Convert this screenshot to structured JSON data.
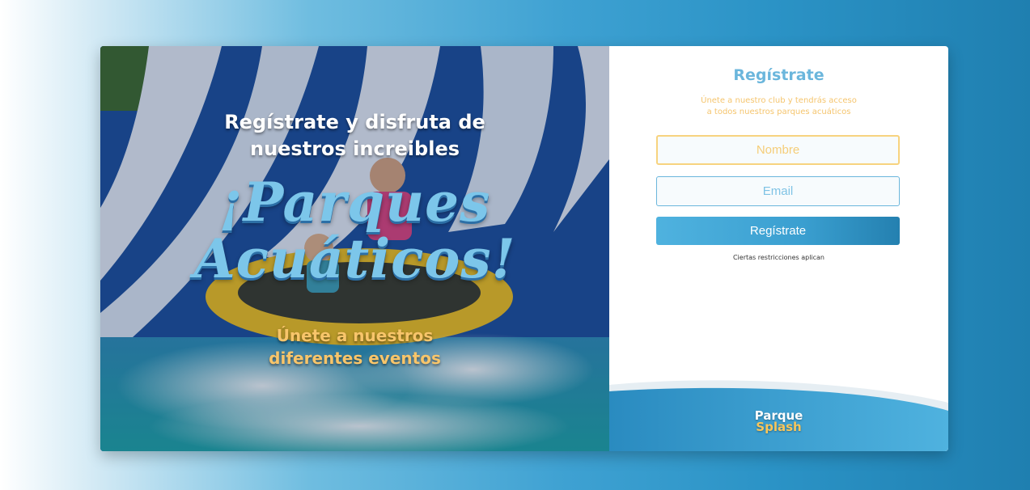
{
  "hero": {
    "headline": "Regístrate y disfruta de nuestros increibles",
    "big_title_line1": "¡Parques",
    "big_title_line2": "Acuáticos!",
    "subtitle": "Únete a nuestros diferentes eventos",
    "image_description": "water-slide-raft-photo"
  },
  "form": {
    "title": "Regístrate",
    "description_line1": "Únete a nuestro club y tendrás acceso",
    "description_line2": "a todos nuestros parques acuáticos",
    "name_placeholder": "Nombre",
    "email_placeholder": "Email",
    "submit_label": "Regístrate",
    "restrictions": "Ciertas restricciones aplican"
  },
  "logo": {
    "line1": "Parque",
    "line2": "Splash"
  },
  "colors": {
    "accent_blue": "#6bb6dc",
    "accent_yellow": "#f5c56e",
    "button_blue": "#3a9fd0"
  }
}
